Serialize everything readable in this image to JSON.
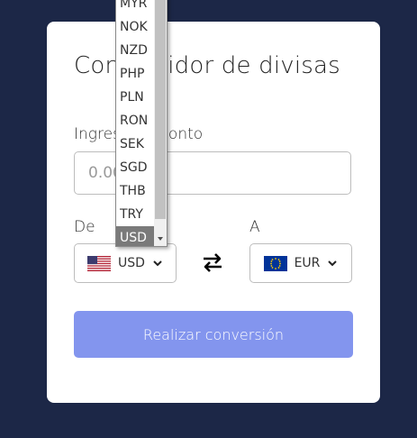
{
  "converter": {
    "title": "Convertidor de divisas",
    "amount_label": "Ingrese el monto",
    "amount_placeholder": "0.00",
    "from_label": "De",
    "to_label": "A",
    "from_currency": "USD",
    "to_currency": "EUR",
    "convert_button": "Realizar conversión"
  },
  "dropdown": {
    "items": [
      "MYR",
      "NOK",
      "NZD",
      "PHP",
      "PLN",
      "RON",
      "SEK",
      "SGD",
      "THB",
      "TRY",
      "USD"
    ],
    "selected": "USD"
  },
  "colors": {
    "background": "#1c2747",
    "card": "#ffffff",
    "button": "#8395ee",
    "selected_item": "#7a7a7a"
  },
  "icons": {
    "from_flag": "us-flag-icon",
    "to_flag": "eu-flag-icon",
    "swap": "swap-arrows-icon",
    "chevron": "chevron-down-icon"
  }
}
